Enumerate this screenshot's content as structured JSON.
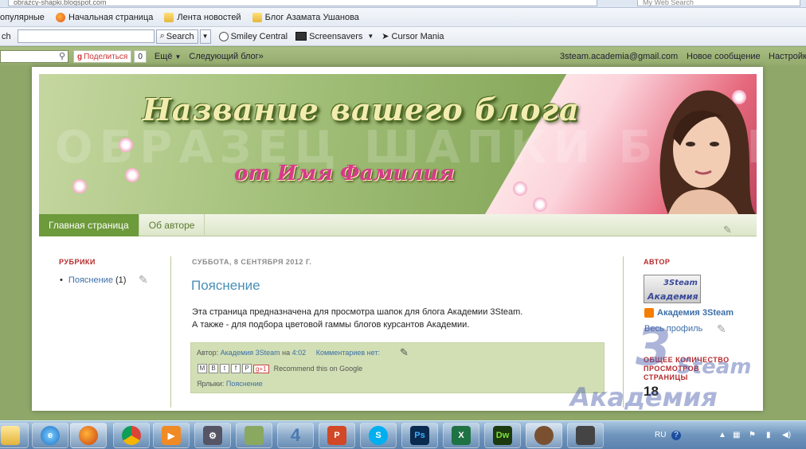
{
  "browser": {
    "url": "obrazcy-shapki.blogspot.com",
    "search_placeholder": "My Web Search",
    "bookmarks": [
      {
        "label": "опулярные",
        "icon": "folder-icon"
      },
      {
        "label": "Начальная страница",
        "icon": "firefox-icon"
      },
      {
        "label": "Лента новостей",
        "icon": "folder-icon"
      },
      {
        "label": "Блог Азамата Ушанова",
        "icon": "folder-icon"
      }
    ],
    "toolbar": {
      "search_prefix": "ch",
      "search_button": "Search",
      "smiley": "Smiley Central",
      "screensavers": "Screensavers",
      "cursor": "Cursor Mania"
    }
  },
  "blogger_nav": {
    "share": "Поделиться",
    "share_count": "0",
    "more": "Ещё",
    "next_blog": "Следующий блог»",
    "email": "3steam.academia@gmail.com",
    "new_post": "Новое сообщение",
    "settings": "Настройк"
  },
  "header": {
    "title": "Название вашего блога",
    "subtitle": "от Имя Фамилия",
    "watermark": "ОБРАЗЕЦ ШАПКИ БЛОГА"
  },
  "tabs": [
    {
      "label": "Главная страница",
      "active": true
    },
    {
      "label": "Об авторе",
      "active": false
    }
  ],
  "left_sidebar": {
    "title": "РУБРИКИ",
    "items": [
      {
        "label": "Пояснение",
        "count": "(1)"
      }
    ]
  },
  "post": {
    "date": "СУББОТА, 8 СЕНТЯБРЯ 2012 Г.",
    "title": "Пояснение",
    "lines": [
      "Эта страница предназначена для просмотра шапок для блога Академии 3Steam.",
      "А также - для подбора цветовой гаммы блогов курсантов Академии."
    ],
    "footer": {
      "author_prefix": "Автор:",
      "author": "Академия 3Steam",
      "at": "на",
      "time": "4:02",
      "comments": "Комментариев нет:",
      "recommend": "Recommend this on Google",
      "labels_prefix": "Ярлыки:",
      "label": "Пояснение",
      "plus": "+1"
    }
  },
  "right_sidebar": {
    "title": "АВТОР",
    "avatar_text_1": "3Steam",
    "avatar_text_2": "Академия",
    "profile_name": "Академия 3Steam",
    "profile_link": "Весь профиль",
    "stats_title": "ОБЩЕЕ КОЛИЧЕСТВО ПРОСМОТРОВ СТРАНИЦЫ",
    "stats_value": "18"
  },
  "watermark": {
    "big": "3",
    "text": "Академия",
    "sub": "Steam"
  },
  "taskbar": {
    "lang": "RU",
    "apps": [
      "explorer",
      "ie",
      "firefox",
      "chrome",
      "media",
      "tool",
      "scan",
      "4",
      "ppt",
      "skype",
      "Ps",
      "excel",
      "Dw",
      "monkey",
      "cam"
    ]
  }
}
